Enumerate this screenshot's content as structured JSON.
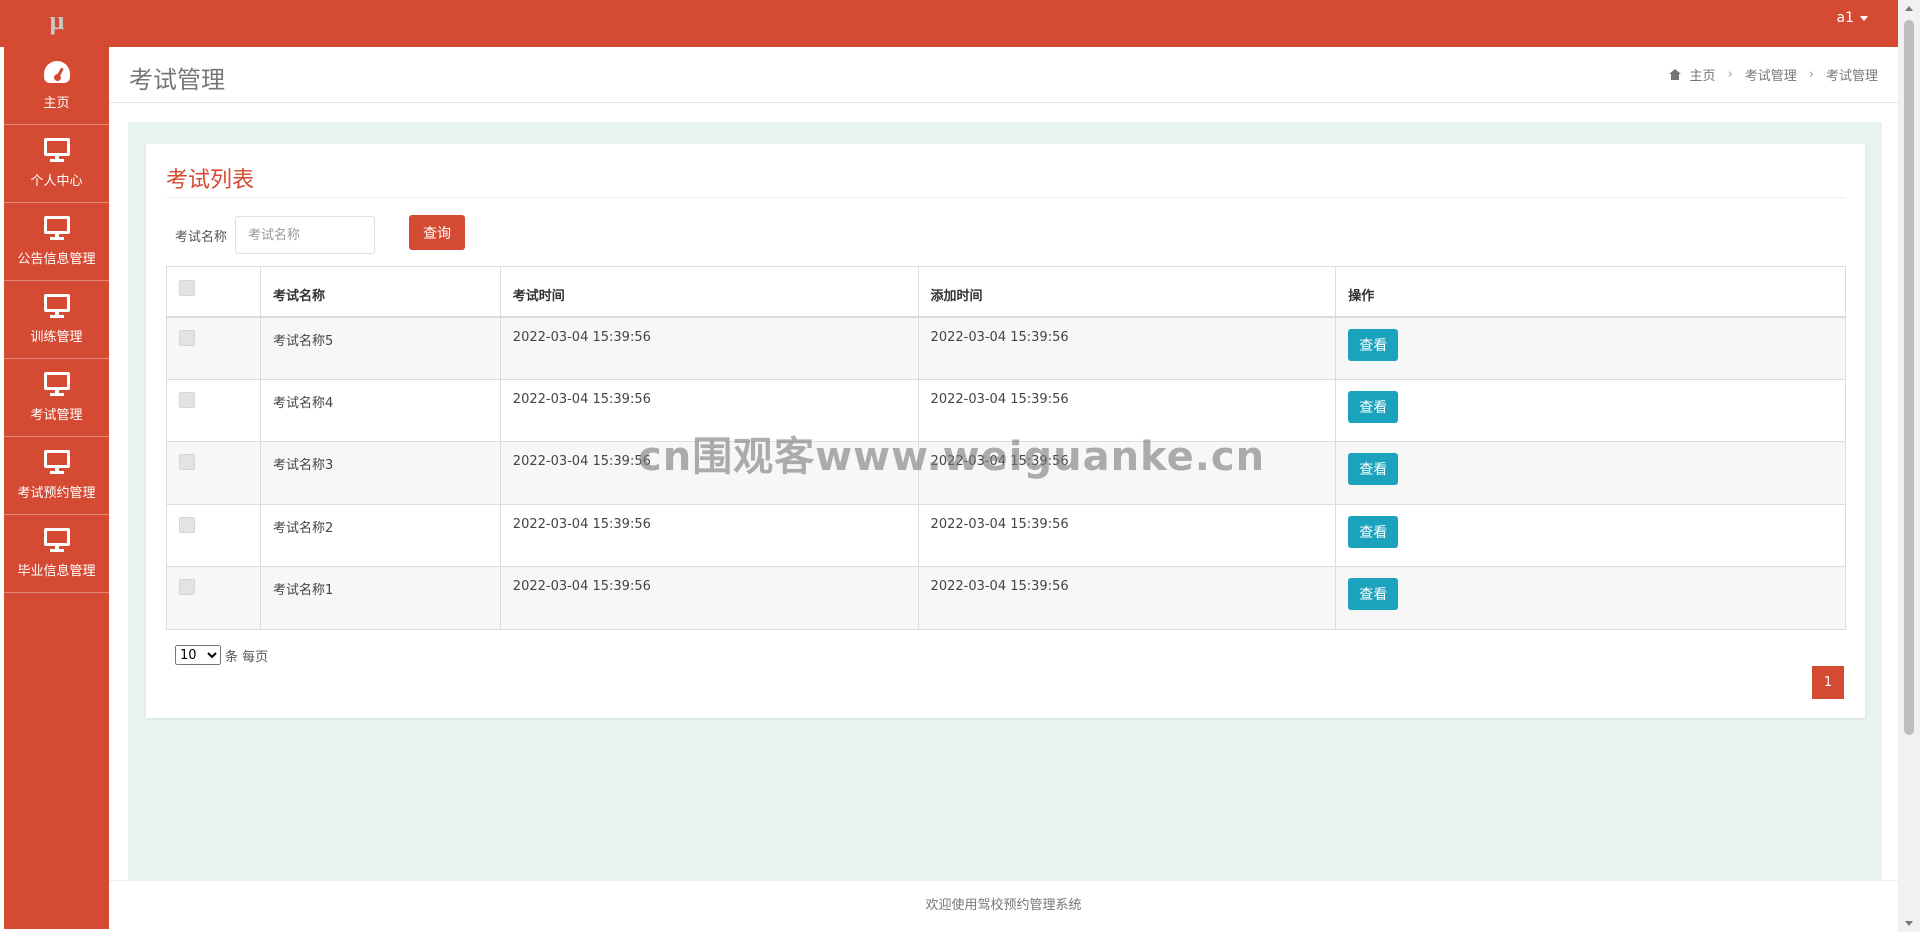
{
  "topbar": {
    "logo_text": "μ",
    "user_name": "a1",
    "brand_color": "#d54a33"
  },
  "sidebar": {
    "items": [
      {
        "label": "主页",
        "icon": "dashboard-icon"
      },
      {
        "label": "个人中心",
        "icon": "monitor-icon"
      },
      {
        "label": "公告信息管理",
        "icon": "monitor-icon"
      },
      {
        "label": "训练管理",
        "icon": "monitor-icon"
      },
      {
        "label": "考试管理",
        "icon": "monitor-icon"
      },
      {
        "label": "考试预约管理",
        "icon": "monitor-icon"
      },
      {
        "label": "毕业信息管理",
        "icon": "monitor-icon"
      }
    ]
  },
  "header": {
    "title": "考试管理",
    "breadcrumb": [
      "主页",
      "考试管理",
      "考试管理"
    ]
  },
  "card": {
    "title": "考试列表",
    "search_label": "考试名称",
    "search_placeholder": "考试名称",
    "search_value": "",
    "search_button": "查询"
  },
  "table": {
    "columns": [
      "",
      "考试名称",
      "考试时间",
      "添加时间",
      "操作"
    ],
    "rows": [
      {
        "name": "考试名称5",
        "exam_time": "2022-03-04 15:39:56",
        "add_time": "2022-03-04 15:39:56",
        "action": "查看"
      },
      {
        "name": "考试名称4",
        "exam_time": "2022-03-04 15:39:56",
        "add_time": "2022-03-04 15:39:56",
        "action": "查看"
      },
      {
        "name": "考试名称3",
        "exam_time": "2022-03-04 15:39:56",
        "add_time": "2022-03-04 15:39:56",
        "action": "查看"
      },
      {
        "name": "考试名称2",
        "exam_time": "2022-03-04 15:39:56",
        "add_time": "2022-03-04 15:39:56",
        "action": "查看"
      },
      {
        "name": "考试名称1",
        "exam_time": "2022-03-04 15:39:56",
        "add_time": "2022-03-04 15:39:56",
        "action": "查看"
      }
    ]
  },
  "pagination": {
    "page_size": "10",
    "page_size_suffix": "条 每页",
    "current_page": "1"
  },
  "watermark": "cn围观客www.weiguanke.cn",
  "footer": {
    "text": "欢迎使用驾校预约管理系统"
  }
}
